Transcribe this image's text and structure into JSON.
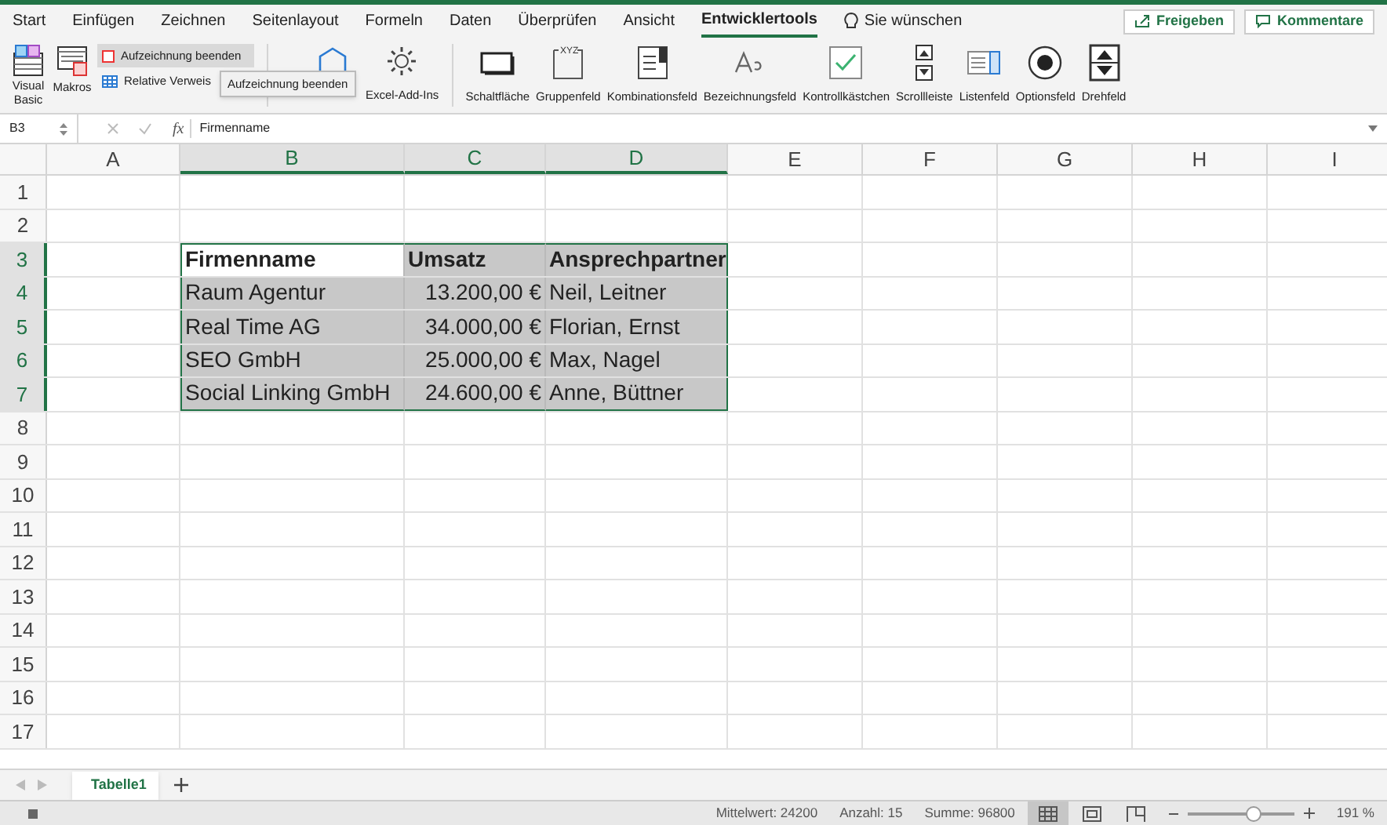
{
  "ribbon_tabs": [
    {
      "label": "Start",
      "selected": false
    },
    {
      "label": "Einfügen",
      "selected": false
    },
    {
      "label": "Zeichnen",
      "selected": false
    },
    {
      "label": "Seitenlayout",
      "selected": false
    },
    {
      "label": "Formeln",
      "selected": false
    },
    {
      "label": "Daten",
      "selected": false
    },
    {
      "label": "Überprüfen",
      "selected": false
    },
    {
      "label": "Ansicht",
      "selected": false
    },
    {
      "label": "Entwicklertools",
      "selected": true
    }
  ],
  "tell_me": "Sie wünschen",
  "share_button": "Freigeben",
  "comments_button": "Kommentare",
  "code_group": {
    "visual_basic": "Visual Basic",
    "macros": "Makros",
    "record_button": "Aufzeichnung beenden",
    "relative_refs": "Relative Verweis",
    "tooltip": "Aufzeichnung beenden"
  },
  "addins_group": {
    "excel_addins": "Excel-Add-Ins"
  },
  "controls": [
    {
      "kind": "button",
      "label": "Schaltfläche"
    },
    {
      "kind": "groupbox",
      "label": "Gruppenfeld",
      "icon_text": "XYZ"
    },
    {
      "kind": "combo",
      "label": "Kombinationsfeld"
    },
    {
      "kind": "label",
      "label": "Bezeichnungsfeld"
    },
    {
      "kind": "checkbox",
      "label": "Kontrollkästchen"
    },
    {
      "kind": "scrollbar",
      "label": "Scrollleiste"
    },
    {
      "kind": "listbox",
      "label": "Listenfeld"
    },
    {
      "kind": "radio",
      "label": "Optionsfeld"
    },
    {
      "kind": "spinner",
      "label": "Drehfeld"
    }
  ],
  "formula_bar": {
    "cell_ref": "B3",
    "function_label": "fx",
    "formula": "Firmenname"
  },
  "columns": [
    {
      "label": "A",
      "selected": false
    },
    {
      "label": "B",
      "selected": true
    },
    {
      "label": "C",
      "selected": true
    },
    {
      "label": "D",
      "selected": true
    },
    {
      "label": "E",
      "selected": false
    },
    {
      "label": "F",
      "selected": false
    },
    {
      "label": "G",
      "selected": false
    },
    {
      "label": "H",
      "selected": false
    },
    {
      "label": "I",
      "selected": false
    }
  ],
  "rows": [
    {
      "label": "1",
      "selected": false
    },
    {
      "label": "2",
      "selected": false
    },
    {
      "label": "3",
      "selected": true,
      "cells": [
        {
          "text": "Firmenname",
          "bold": true,
          "active": true
        },
        {
          "text": "Umsatz",
          "bold": true,
          "active": false
        },
        {
          "text": "Ansprechpartner",
          "bold": true,
          "active": false
        }
      ]
    },
    {
      "label": "4",
      "selected": true,
      "cells": [
        {
          "text": "Raum Agentur",
          "bold": false,
          "active": false
        },
        {
          "text": "13.200,00 €",
          "bold": false,
          "active": false
        },
        {
          "text": "Neil, Leitner",
          "bold": false,
          "active": false
        }
      ]
    },
    {
      "label": "5",
      "selected": true,
      "cells": [
        {
          "text": "Real Time AG",
          "bold": false,
          "active": false
        },
        {
          "text": "34.000,00 €",
          "bold": false,
          "active": false
        },
        {
          "text": "Florian, Ernst",
          "bold": false,
          "active": false
        }
      ]
    },
    {
      "label": "6",
      "selected": true,
      "cells": [
        {
          "text": "SEO GmbH",
          "bold": false,
          "active": false
        },
        {
          "text": "25.000,00 €",
          "bold": false,
          "active": false
        },
        {
          "text": "Max, Nagel",
          "bold": false,
          "active": false
        }
      ]
    },
    {
      "label": "7",
      "selected": true,
      "cells": [
        {
          "text": "Social Linking GmbH",
          "bold": false,
          "active": false
        },
        {
          "text": "24.600,00 €",
          "bold": false,
          "active": false
        },
        {
          "text": "Anne, Büttner",
          "bold": false,
          "active": false
        }
      ]
    },
    {
      "label": "8",
      "selected": false
    },
    {
      "label": "9",
      "selected": false
    },
    {
      "label": "10",
      "selected": false
    },
    {
      "label": "11",
      "selected": false
    },
    {
      "label": "12",
      "selected": false
    },
    {
      "label": "13",
      "selected": false
    },
    {
      "label": "14",
      "selected": false
    },
    {
      "label": "15",
      "selected": false
    },
    {
      "label": "16",
      "selected": false
    },
    {
      "label": "17",
      "selected": false
    }
  ],
  "sheet_tabs": [
    {
      "label": "Tabelle1",
      "selected": true
    }
  ],
  "status_bar": {
    "average": "Mittelwert: 24200",
    "count": "Anzahl: 15",
    "sum": "Summe: 96800",
    "views": [
      {
        "kind": "normal",
        "selected": true
      },
      {
        "kind": "pagelayout",
        "selected": false
      },
      {
        "kind": "pagebreak",
        "selected": false
      }
    ],
    "zoom": {
      "level": 0.62,
      "reading": "191 %"
    }
  }
}
